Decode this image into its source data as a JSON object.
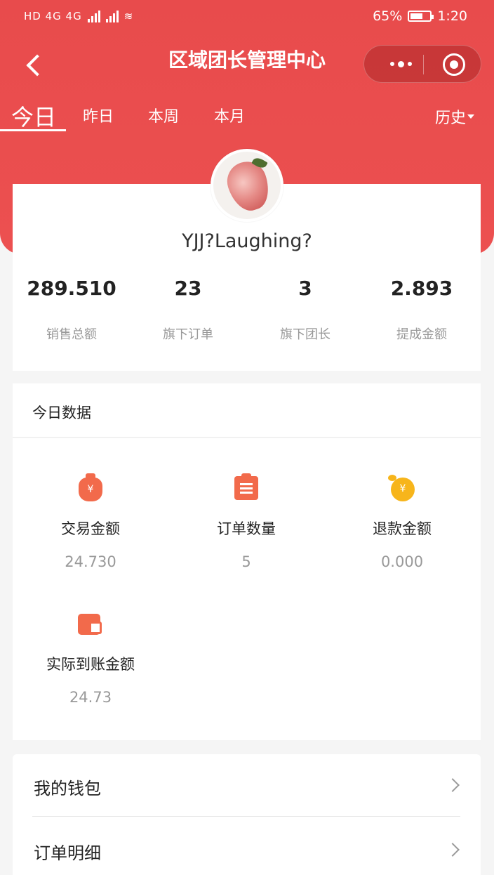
{
  "status_bar": {
    "left_text": "HD 4G 4G",
    "battery": "65%",
    "battery_level": 0.65,
    "time": "1:20"
  },
  "nav": {
    "title": "区域团长管理中心"
  },
  "tabs": [
    {
      "label": "今日",
      "active": true
    },
    {
      "label": "昨日",
      "active": false
    },
    {
      "label": "本周",
      "active": false
    },
    {
      "label": "本月",
      "active": false
    }
  ],
  "history_label": "历史",
  "profile": {
    "avatar": "strawberry-avatar",
    "nickname": "YJJ?Laughing?"
  },
  "stats": [
    {
      "value": "289.510",
      "label": "销售总额"
    },
    {
      "value": "23",
      "label": "旗下订单"
    },
    {
      "value": "3",
      "label": "旗下团长"
    },
    {
      "value": "2.893",
      "label": "提成金额"
    }
  ],
  "today": {
    "title": "今日数据",
    "metrics": [
      {
        "icon": "money-bag-icon",
        "label": "交易金额",
        "value": "24.730"
      },
      {
        "icon": "clipboard-icon",
        "label": "订单数量",
        "value": "5"
      },
      {
        "icon": "coin-icon",
        "label": "退款金额",
        "value": "0.000"
      },
      {
        "icon": "wallet-icon",
        "label": "实际到账金额",
        "value": "24.73"
      }
    ]
  },
  "menu": [
    {
      "label": "我的钱包"
    },
    {
      "label": "订单明细"
    }
  ],
  "colors": {
    "header_red": "#e84b4c",
    "icon_orange": "#f26a4b",
    "icon_yellow": "#f7b51b"
  }
}
